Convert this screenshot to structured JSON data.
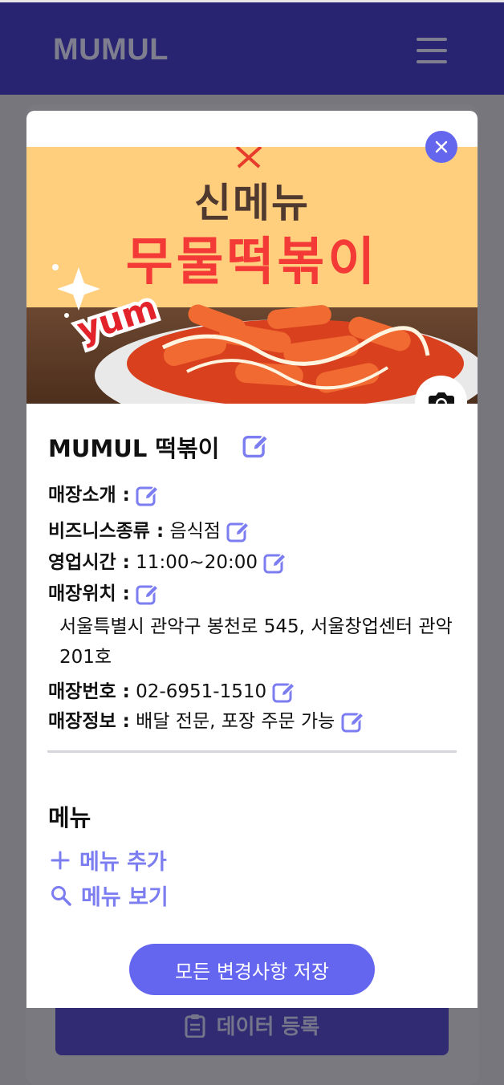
{
  "app": {
    "brand": "MUMUL"
  },
  "background_action": {
    "label": "데이터 등록"
  },
  "banner": {
    "title_line1": "신메뉴",
    "title_line2": "무물떡볶이"
  },
  "store": {
    "name": "MUMUL 떡볶이",
    "fields": [
      {
        "label": "매장소개 :",
        "value": ""
      },
      {
        "label": "비즈니스종류 :",
        "value": "음식점"
      },
      {
        "label": "영업시간 :",
        "value": "11:00~20:00"
      },
      {
        "label": "매장위치 :",
        "value": ""
      },
      {
        "label": "매장번호 :",
        "value": "02-6951-1510"
      },
      {
        "label": "매장정보 :",
        "value": "배달 전문, 포장 주문 가능"
      }
    ],
    "address": "서울특별시 관악구 봉천로 545, 서울창업센터 관악 201호"
  },
  "menu": {
    "title": "메뉴",
    "add_label": "메뉴 추가",
    "view_label": "메뉴 보기"
  },
  "save_button": "모든 변경사항 저장",
  "icons": [
    "menu-icon",
    "clipboard-icon",
    "close-icon",
    "camera-icon",
    "edit-icon",
    "plus-icon",
    "search-icon"
  ],
  "colors": {
    "appbar": "#282471",
    "accent": "#6566f0",
    "banner_bg": "#ffcf7e",
    "banner_title": "#f33a36"
  }
}
